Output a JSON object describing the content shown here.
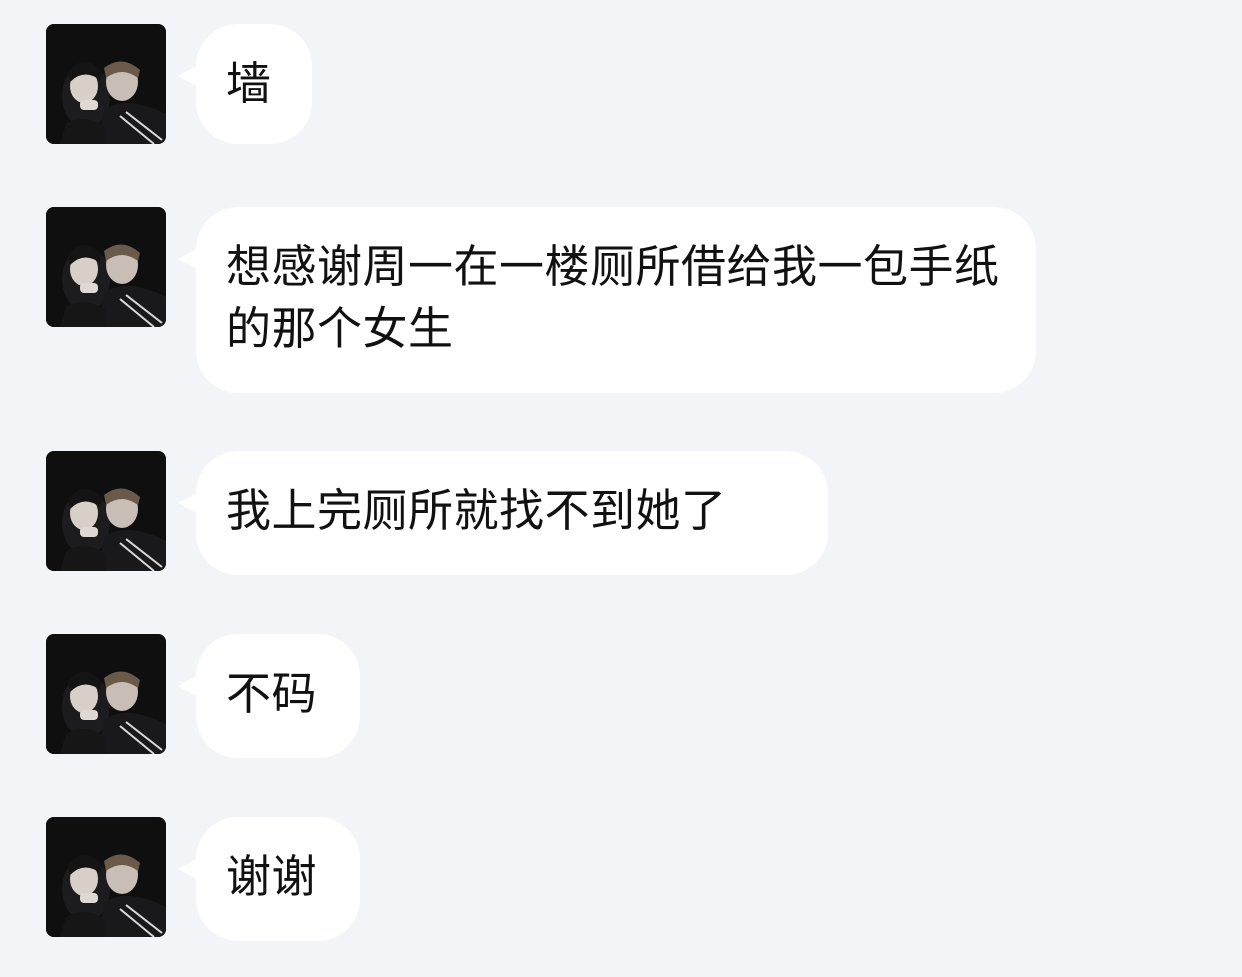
{
  "colors": {
    "background": "#f3f4f8",
    "bubble": "#ffffff",
    "text": "#111111"
  },
  "messages": [
    {
      "text": "墙",
      "avatar_icon": "user-photo-avatar"
    },
    {
      "text": "想感谢周一在一楼厕所借给我一包手纸的那个女生",
      "avatar_icon": "user-photo-avatar"
    },
    {
      "text": "我上完厕所就找不到她了",
      "avatar_icon": "user-photo-avatar"
    },
    {
      "text": "不码",
      "avatar_icon": "user-photo-avatar"
    },
    {
      "text": "谢谢",
      "avatar_icon": "user-photo-avatar"
    }
  ]
}
